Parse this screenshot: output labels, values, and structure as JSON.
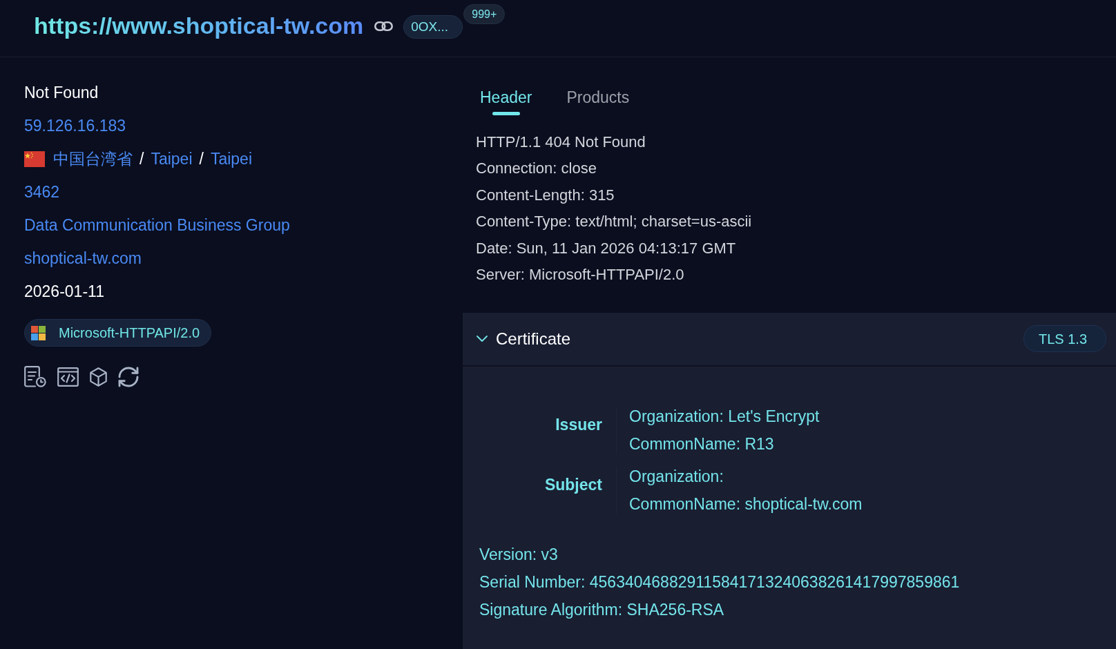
{
  "header": {
    "url": "https://www.shoptical-tw.com",
    "tag": "0OX...",
    "count": "999+"
  },
  "summary": {
    "title": "Not Found",
    "ip": "59.126.16.183",
    "location": {
      "parts": [
        "中国台湾省",
        "Taipei",
        "Taipei"
      ],
      "separators": [
        "/",
        "/"
      ]
    },
    "asn": "3462",
    "organization": "Data Communication Business Group",
    "domain": "shoptical-tw.com",
    "date": "2026-01-11",
    "server": "Microsoft-HTTPAPI/2.0"
  },
  "tabs": [
    {
      "label": "Header",
      "selected": true
    },
    {
      "label": "Products",
      "selected": false
    }
  ],
  "header_lines": [
    "HTTP/1.1 404 Not Found",
    "Connection: close",
    "Content-Length: 315",
    "Content-Type: text/html; charset=us-ascii",
    "Date: Sun, 11 Jan 2026 04:13:17 GMT",
    "Server: Microsoft-HTTPAPI/2.0"
  ],
  "certificate": {
    "title": "Certificate",
    "expanded": true,
    "protocol": "TLS 1.3",
    "parties": [
      {
        "label": "Issuer",
        "lines": [
          "Organization: Let's Encrypt",
          "CommonName: R13"
        ]
      },
      {
        "label": "Subject",
        "lines": [
          "Organization:",
          "CommonName: shoptical-tw.com"
        ]
      }
    ],
    "details": [
      "Version: v3",
      "Serial Number: 456340468829115841713240638261417997859861",
      "Signature Algorithm: SHA256-RSA"
    ]
  }
}
